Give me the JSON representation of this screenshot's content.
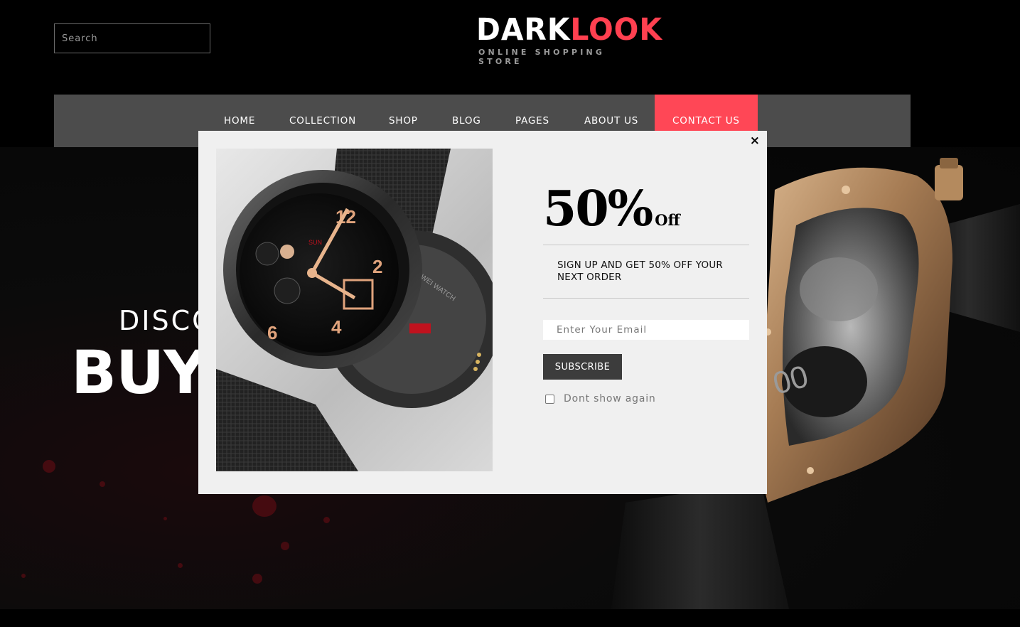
{
  "header": {
    "search_placeholder": "Search",
    "logo_dark": "DARK",
    "logo_look": "LOOK",
    "logo_tagline": "ONLINE SHOPPING STORE"
  },
  "nav": {
    "items": [
      {
        "label": "HOME"
      },
      {
        "label": "COLLECTION"
      },
      {
        "label": "SHOP"
      },
      {
        "label": "BLOG"
      },
      {
        "label": "PAGES"
      },
      {
        "label": "ABOUT US"
      },
      {
        "label": "CONTACT US"
      }
    ]
  },
  "hero": {
    "line1": "DISCO",
    "line2": "BUY"
  },
  "popup": {
    "close_label": "×",
    "discount": "50%",
    "discount_suffix": "Off",
    "signup_text": "SIGN UP AND GET 50% OFF YOUR NEXT ORDER",
    "email_placeholder": "Enter Your Email",
    "subscribe_label": "SUBSCRIBE",
    "dont_show_label": "Dont show again"
  },
  "colors": {
    "accent": "#ff4756",
    "nav_bg": "#4c4c4c",
    "popup_bg": "#f0f0f0",
    "button_bg": "#3c3c3c"
  }
}
